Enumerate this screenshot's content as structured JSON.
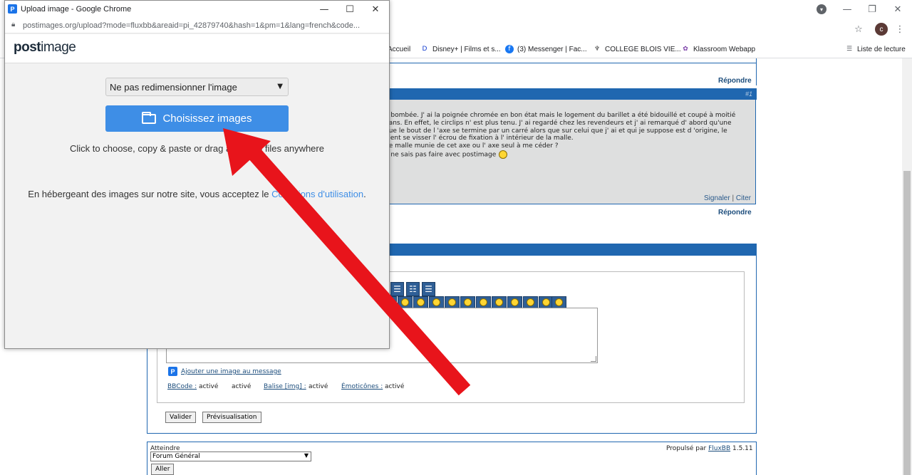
{
  "browser": {
    "bookmarks": [
      {
        "label": "Accueil",
        "icon": "bookmark-icon"
      },
      {
        "label": "Disney+ | Films et s...",
        "icon": "disney-icon"
      },
      {
        "label": "(3) Messenger | Fac...",
        "icon": "facebook-icon"
      },
      {
        "label": "COLLEGE BLOIS VIE...",
        "icon": "college-icon"
      },
      {
        "label": "Klassroom Webapp",
        "icon": "klassroom-icon"
      }
    ],
    "reading_list": "Liste de lecture",
    "profile_initial": "c"
  },
  "popup": {
    "title": "Upload image - Google Chrome",
    "url": "postimages.org/upload?mode=fluxbb&areaid=pi_42879740&hash=1&pm=1&lang=french&code...",
    "logo_a": "post",
    "logo_b": "image",
    "resize_select": "Ne pas redimensionner l'image",
    "choose_button": "Choisissez images",
    "hint": "Click to choose, copy & paste or drag and drop files anywhere",
    "terms_prefix": "En hébergeant des images sur notre site, vous acceptez le ",
    "terms_link": "Conditions d'utilisation",
    "terms_suffix": "."
  },
  "forum": {
    "reply_top": "Répondre",
    "post_number": "#1",
    "post_lines": [
      "e bombée. J' ai la poignée chromée en bon état mais le logement du barillet a été bidouillé et coupé  à moitié",
      "dans. En effet, le circlips n' est plus tenu. J' ai regardé chez les revendeurs et j' ai remarqué d' abord qu'une",
      " que le bout de l 'axe se termine par un carré alors que sur celui que j' ai et qui je suppose est d 'origine, le",
      "vient se visser l' écrou de fixation à l' intérieur de la malle.",
      "de malle munie de cet axe ou l' axe seul à me céder ?",
      "e ne sais pas faire avec postimage"
    ],
    "report": "Signaler",
    "separator": "|",
    "quote": "Citer",
    "reply_bottom": "Répondre",
    "add_image": "Ajouter une image au message",
    "bbcode": "BBCode :",
    "bbcode_state": "activé",
    "extra_state": "activé",
    "img_tag": "Balise [img] :",
    "img_state": "activé",
    "smileys": "Émoticônes :",
    "smileys_state": "activé",
    "submit": "Valider",
    "preview": "Prévisualisation",
    "goto_label": "Atteindre",
    "goto_select": "Forum Général",
    "goto_button": "Aller",
    "powered_prefix": "Propulsé par ",
    "powered_link": "FluxBB",
    "powered_version": " 1.5.11"
  },
  "annotation": {
    "color": "#e8141b"
  }
}
